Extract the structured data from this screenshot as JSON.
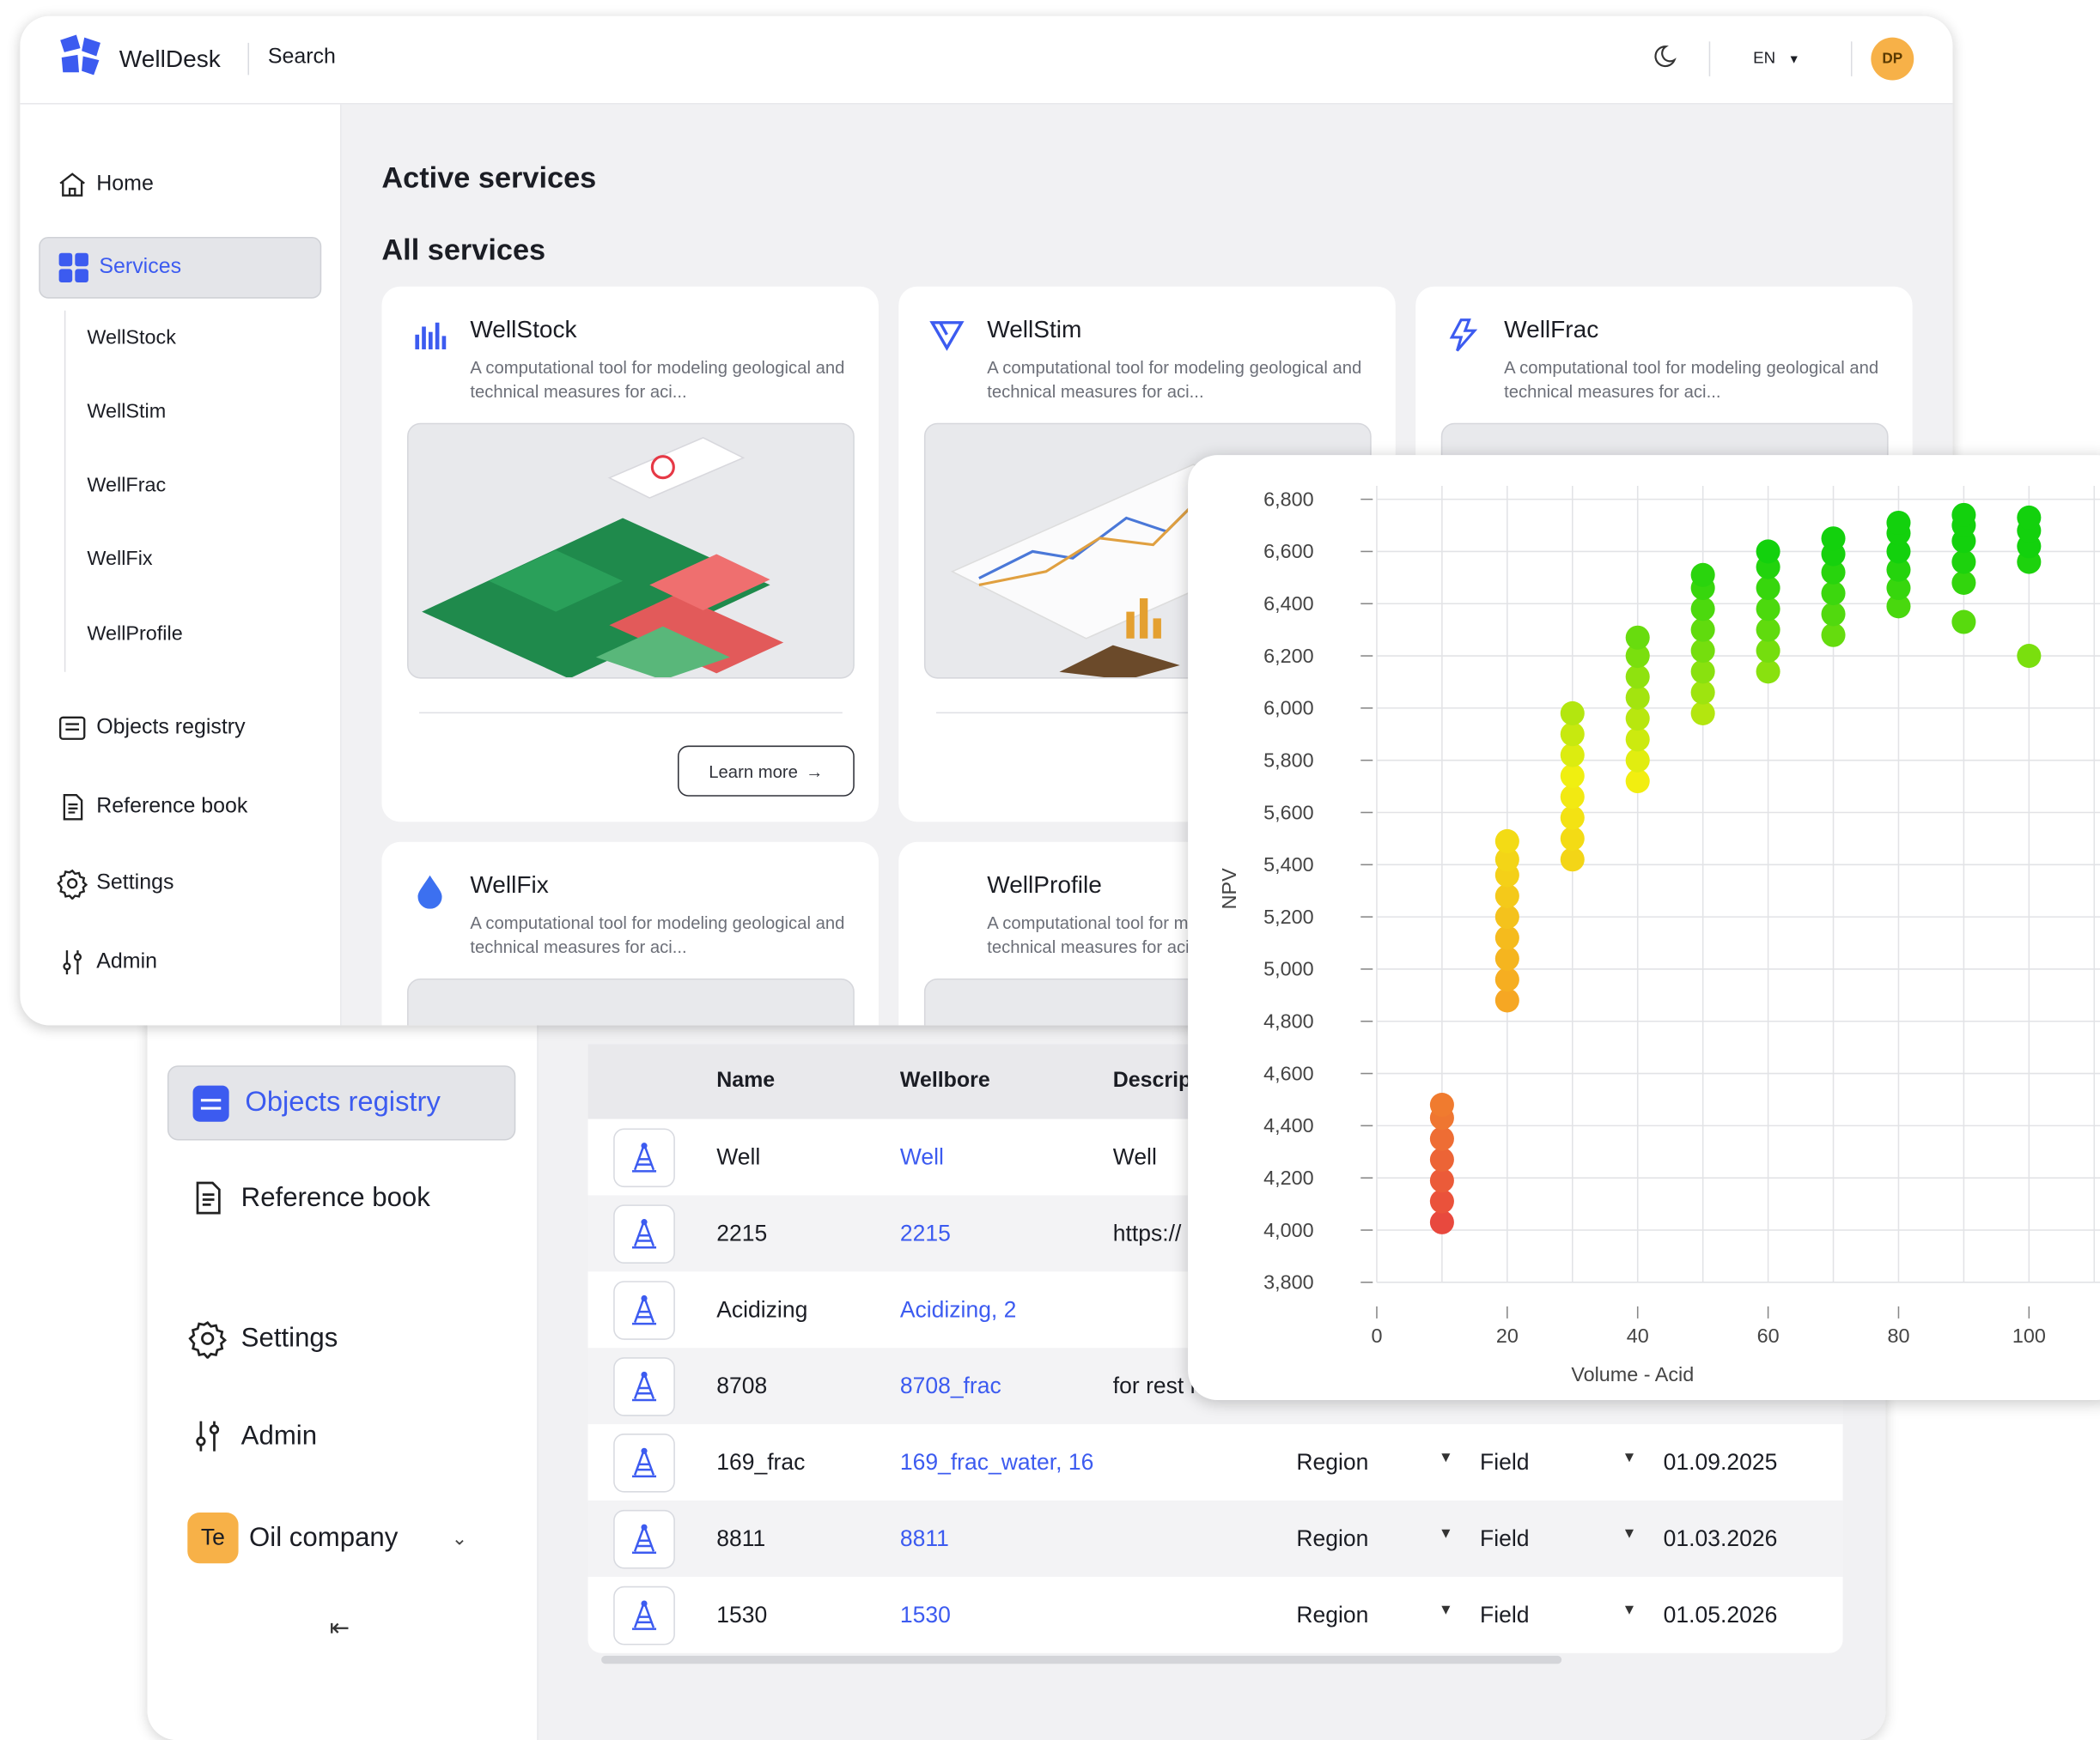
{
  "front": {
    "app_name": "WellDesk",
    "search_label": "Search",
    "lang": "EN",
    "avatar_initials": "DP",
    "sidebar": {
      "home": "Home",
      "services": "Services",
      "sub_items": [
        "WellStock",
        "WellStim",
        "WellFrac",
        "WellFix",
        "WellProfile"
      ],
      "objects_registry": "Objects registry",
      "reference_book": "Reference book",
      "settings": "Settings",
      "admin": "Admin"
    },
    "main": {
      "active_services": "Active services",
      "all_services": "All services",
      "cards": [
        {
          "title": "WellStock",
          "desc": "A computational tool for modeling geological and technical measures for aci...",
          "learn_more": "Learn more",
          "icon": "bar-chart-icon"
        },
        {
          "title": "WellStim",
          "desc": "A computational tool for modeling geological and technical measures for aci...",
          "icon": "funnel-icon"
        },
        {
          "title": "WellFrac",
          "desc": "A computational tool for modeling geological and technical measures for aci...",
          "icon": "lightning-icon"
        },
        {
          "title": "WellFix",
          "desc": "A computational tool for modeling geological and technical measures for aci...",
          "icon": "droplet-icon"
        },
        {
          "title": "WellProfile",
          "desc": "A computational tool for modeling geological and technical measures for aci...",
          "icon": "profile-icon"
        }
      ]
    }
  },
  "back": {
    "sidebar": {
      "objects_registry": "Objects registry",
      "reference_book": "Reference book",
      "settings": "Settings",
      "admin": "Admin",
      "org_initials": "Te",
      "org_name": "Oil company"
    },
    "table": {
      "headers": {
        "name": "Name",
        "wellbore": "Wellbore",
        "description": "Descrip"
      },
      "rows": [
        {
          "name": "Well",
          "wellbore": "Well",
          "description": "Well",
          "region": "",
          "field": "",
          "date": ""
        },
        {
          "name": "2215",
          "wellbore": "2215",
          "description": "https://",
          "region": "",
          "field": "",
          "date": ""
        },
        {
          "name": "Acidizing",
          "wellbore": "Acidizing, 2",
          "description": "",
          "region": "",
          "field": "",
          "date": ""
        },
        {
          "name": "8708",
          "wellbore": "8708_frac",
          "description": "for rest n",
          "region": "",
          "field": "",
          "date": ""
        },
        {
          "name": "169_frac",
          "wellbore": "169_frac_water, 16",
          "description": "",
          "region": "Region",
          "field": "Field",
          "date": "01.09.2025"
        },
        {
          "name": "8811",
          "wellbore": "8811",
          "description": "",
          "region": "Region",
          "field": "Field",
          "date": "01.03.2026"
        },
        {
          "name": "1530",
          "wellbore": "1530",
          "description": "",
          "region": "Region",
          "field": "Field",
          "date": "01.05.2026"
        }
      ]
    }
  },
  "colors": {
    "accent": "#3c5bf0",
    "avatar": "#f7b148"
  },
  "chart_data": {
    "type": "scatter",
    "xlabel": "Volume - Acid",
    "ylabel": "NPV",
    "xlim": [
      0,
      100
    ],
    "ylim": [
      3800,
      6800
    ],
    "x_ticks": [
      0,
      20,
      40,
      60,
      80,
      100
    ],
    "y_ticks": [
      3800,
      4000,
      4200,
      4400,
      4600,
      4800,
      5000,
      5200,
      5400,
      5600,
      5800,
      6000,
      6200,
      6400,
      6600,
      6800
    ],
    "color_scale": [
      "#e8463f",
      "#f6a623",
      "#f2ef10",
      "#13d10d"
    ],
    "series": [
      {
        "x": 10,
        "y": [
          4030,
          4110,
          4190,
          4270,
          4350,
          4430,
          4480
        ]
      },
      {
        "x": 20,
        "y": [
          4880,
          4960,
          5040,
          5120,
          5200,
          5280,
          5360,
          5420,
          5490
        ]
      },
      {
        "x": 30,
        "y": [
          5420,
          5500,
          5580,
          5660,
          5740,
          5820,
          5900,
          5980
        ]
      },
      {
        "x": 40,
        "y": [
          5720,
          5800,
          5880,
          5960,
          6040,
          6120,
          6200,
          6270
        ]
      },
      {
        "x": 50,
        "y": [
          5980,
          6060,
          6140,
          6220,
          6300,
          6380,
          6460,
          6510
        ]
      },
      {
        "x": 60,
        "y": [
          6140,
          6220,
          6300,
          6380,
          6460,
          6540,
          6600
        ]
      },
      {
        "x": 70,
        "y": [
          6280,
          6360,
          6440,
          6520,
          6590,
          6650
        ]
      },
      {
        "x": 80,
        "y": [
          6390,
          6460,
          6530,
          6600,
          6670,
          6710
        ]
      },
      {
        "x": 90,
        "y": [
          6330,
          6480,
          6560,
          6640,
          6700,
          6740
        ]
      },
      {
        "x": 100,
        "y": [
          6200,
          6560,
          6620,
          6680,
          6730
        ]
      }
    ]
  }
}
